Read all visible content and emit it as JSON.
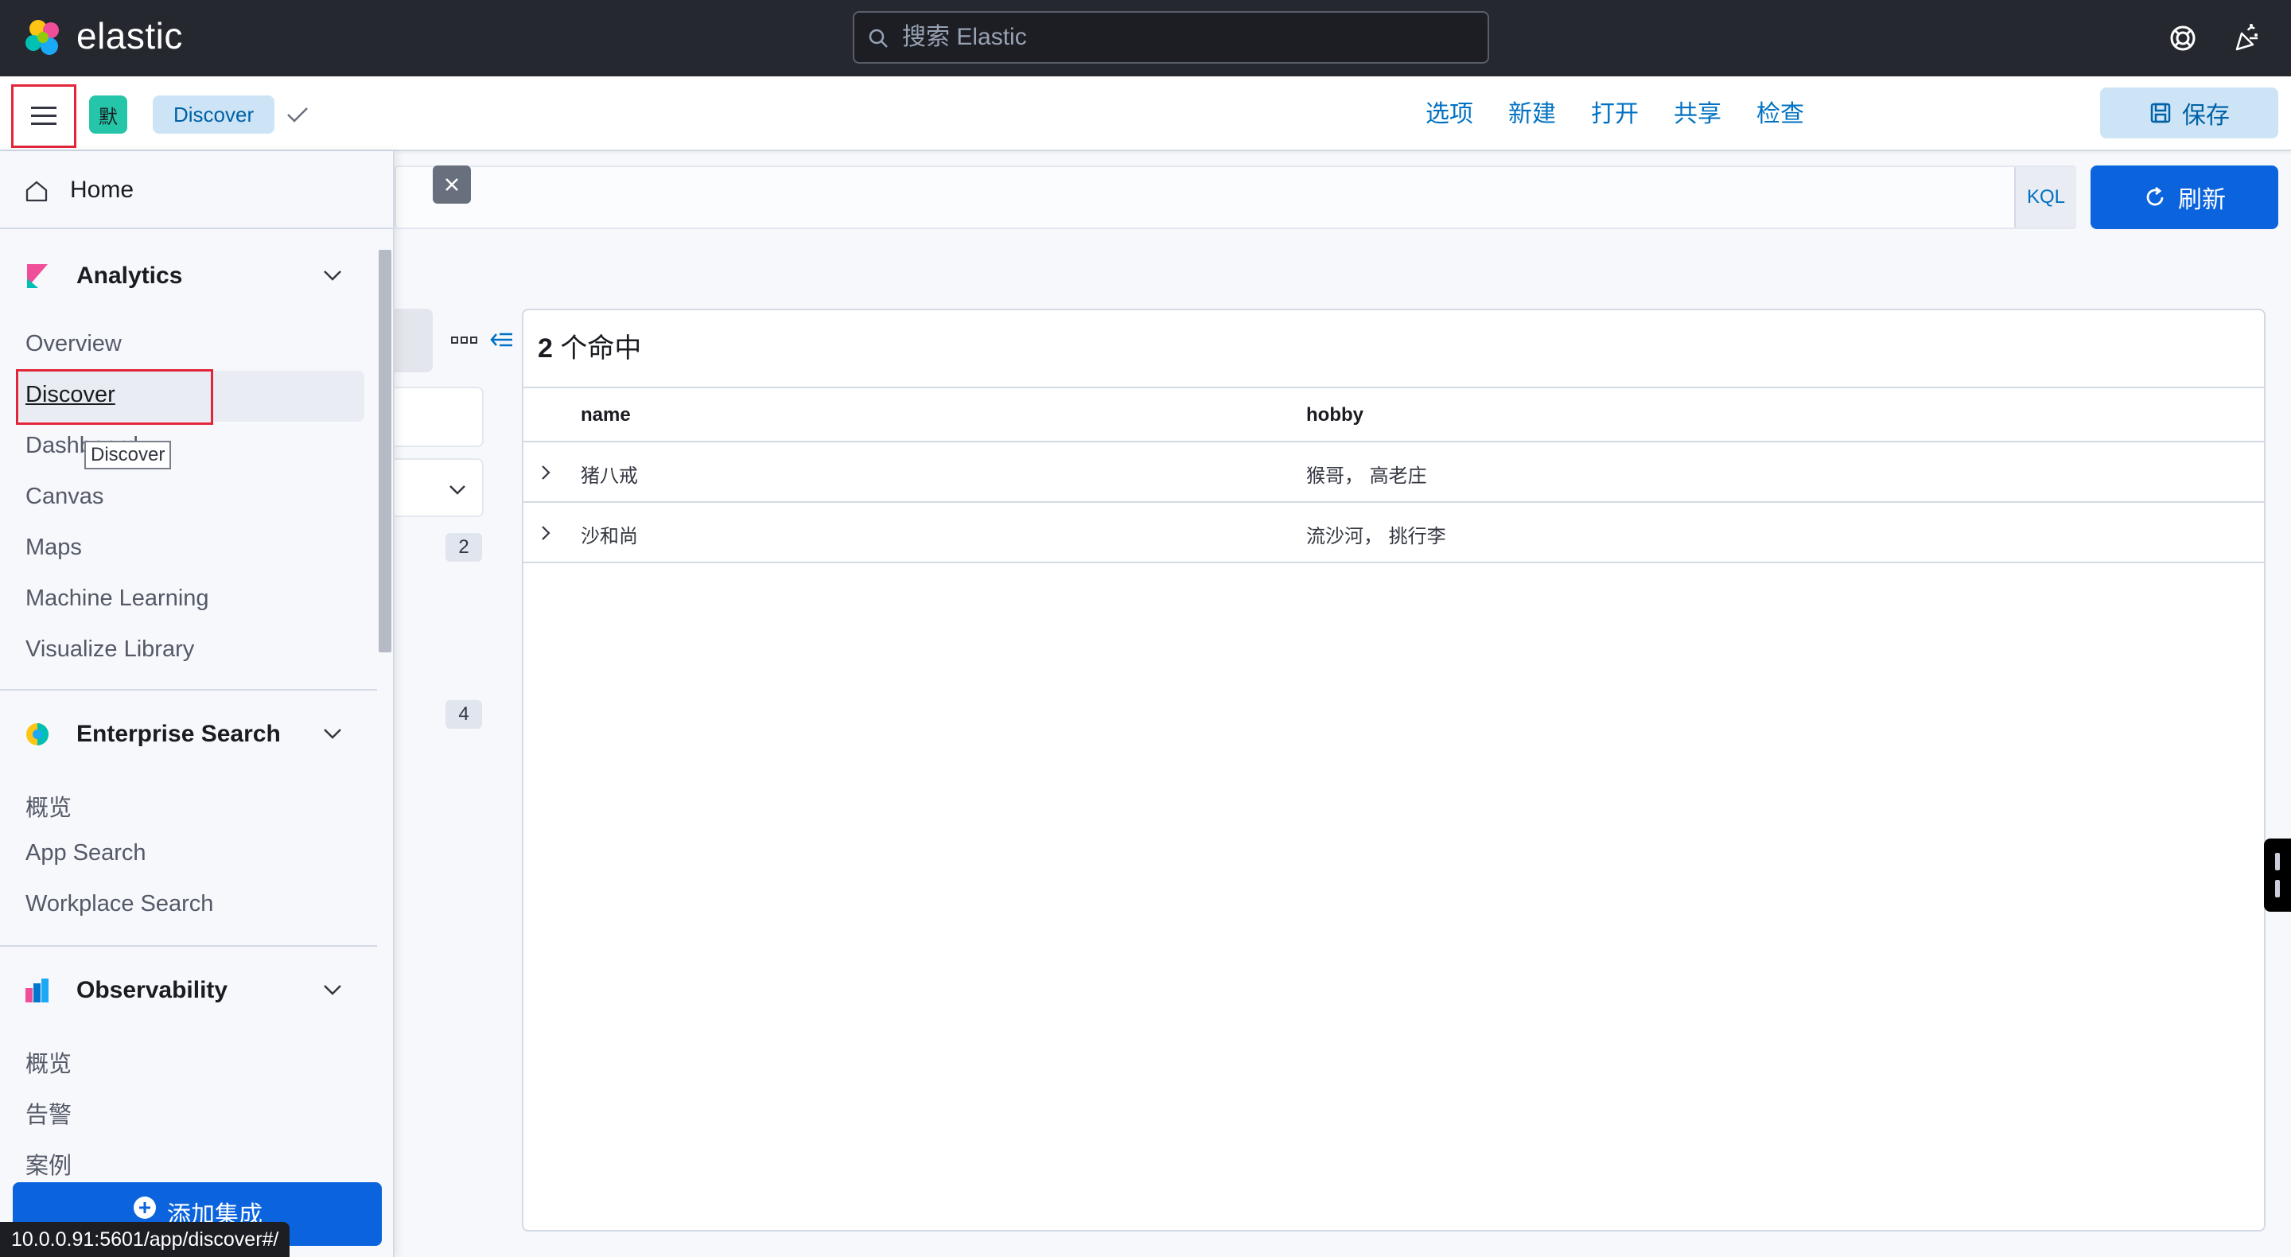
{
  "header": {
    "brand": "elastic",
    "search_placeholder": "搜索 Elastic",
    "help_icon": "help-icon",
    "news_icon": "newsfeed-icon"
  },
  "appbar": {
    "space_initial": "默",
    "breadcrumb": "Discover",
    "links": [
      "选项",
      "新建",
      "打开",
      "共享",
      "检查"
    ],
    "save_label": "保存"
  },
  "query": {
    "language": "KQL",
    "refresh_label": "刷新"
  },
  "field_sidebar": {
    "counts": [
      "2",
      "4"
    ]
  },
  "results": {
    "hits_count": "2",
    "hits_suffix": " 个命中",
    "columns": [
      "name",
      "hobby"
    ],
    "rows": [
      {
        "name": "猪八戒",
        "hobby": "猴哥， 高老庄"
      },
      {
        "name": "沙和尚",
        "hobby": "流沙河， 挑行李"
      }
    ]
  },
  "nav": {
    "home": "Home",
    "analytics": {
      "title": "Analytics",
      "items": [
        "Overview",
        "Discover",
        "Dashboard",
        "Canvas",
        "Maps",
        "Machine Learning",
        "Visualize Library"
      ]
    },
    "enterprise": {
      "title": "Enterprise Search",
      "items": [
        "概览",
        "App Search",
        "Workplace Search"
      ]
    },
    "observability": {
      "title": "Observability",
      "items": [
        "概览",
        "告警",
        "案例"
      ]
    },
    "tooltip": "Discover",
    "add_integrations": "添加集成"
  },
  "status_bar": {
    "url": "10.0.0.91:5601/app/discover#/"
  },
  "colors": {
    "header_bg": "#25282f",
    "accent": "#0b64dd",
    "link": "#0071c2",
    "highlight_red": "#e2263a"
  }
}
